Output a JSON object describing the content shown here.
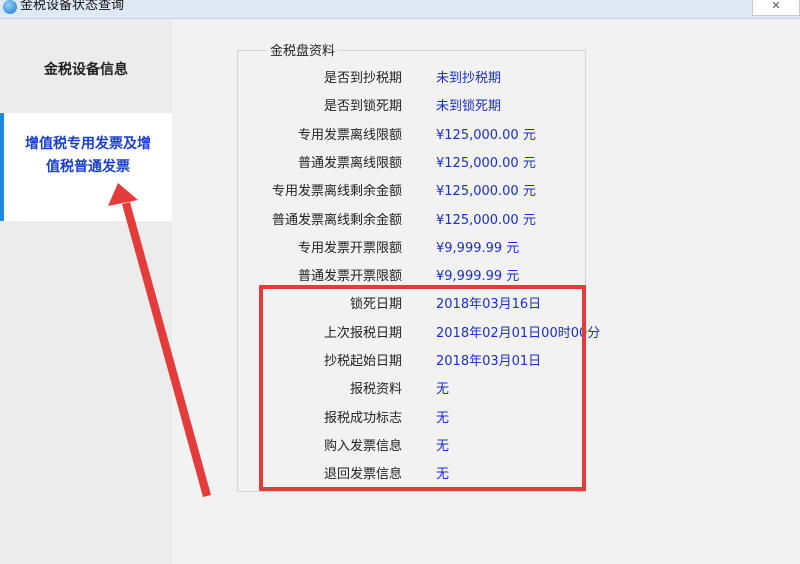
{
  "window": {
    "title": "金税设备状态查询",
    "close_label": "✕"
  },
  "sidebar": {
    "items": [
      {
        "label_lines": [
          "金税设备信息"
        ]
      },
      {
        "label_lines": [
          "增值税专用发票及增",
          "值税普通发票"
        ]
      }
    ]
  },
  "panel": {
    "legend": "金税盘资料",
    "rows": [
      {
        "label": "是否到抄税期",
        "value": "未到抄税期"
      },
      {
        "label": "是否到锁死期",
        "value": "未到锁死期"
      },
      {
        "label": "专用发票离线限额",
        "value": "¥125,000.00 元"
      },
      {
        "label": "普通发票离线限额",
        "value": "¥125,000.00 元"
      },
      {
        "label": "专用发票离线剩余金额",
        "value": "¥125,000.00 元"
      },
      {
        "label": "普通发票离线剩余金额",
        "value": "¥125,000.00 元"
      },
      {
        "label": "专用发票开票限额",
        "value": "¥9,999.99 元"
      },
      {
        "label": "普通发票开票限额",
        "value": "¥9,999.99 元"
      },
      {
        "label": "锁死日期",
        "value": "2018年03月16日"
      },
      {
        "label": "上次报税日期",
        "value": "2018年02月01日00时00分"
      },
      {
        "label": "抄税起始日期",
        "value": "2018年03月01日"
      },
      {
        "label": "报税资料",
        "value": "无"
      },
      {
        "label": "报税成功标志",
        "value": "无"
      },
      {
        "label": "购入发票信息",
        "value": "无"
      },
      {
        "label": "退回发票信息",
        "value": "无"
      }
    ]
  },
  "annotation": {
    "color": "#e43b3b"
  }
}
